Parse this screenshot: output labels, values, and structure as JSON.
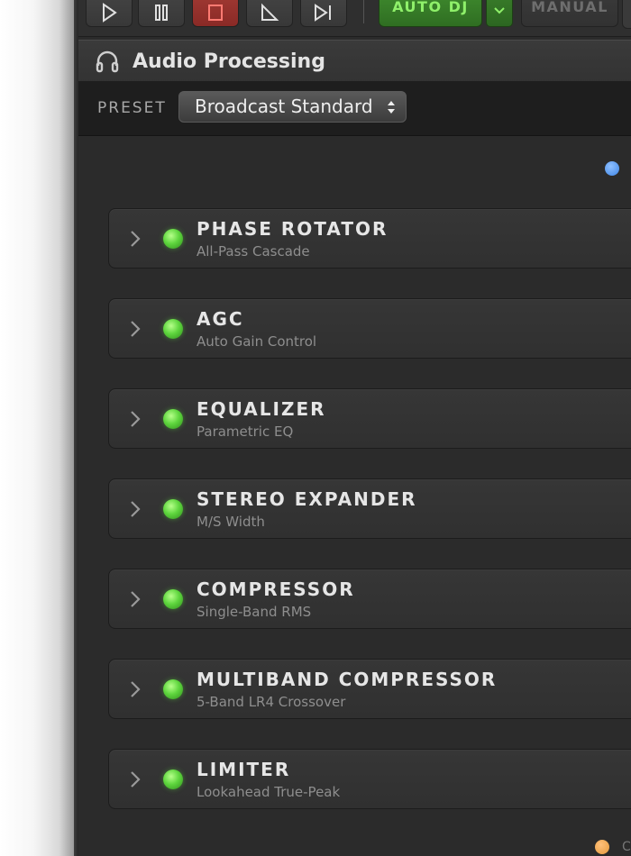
{
  "toolbar": {
    "auto_dj_label": "AUTO DJ",
    "manual_label": "MANUAL"
  },
  "panel": {
    "title": "Audio Processing",
    "preset_label": "PRESET",
    "preset_value": "Broadcast Standard"
  },
  "modules": [
    {
      "name": "PHASE ROTATOR",
      "subtitle": "All-Pass Cascade"
    },
    {
      "name": "AGC",
      "subtitle": "Auto Gain Control"
    },
    {
      "name": "EQUALIZER",
      "subtitle": "Parametric EQ"
    },
    {
      "name": "STEREO EXPANDER",
      "subtitle": "M/S Width"
    },
    {
      "name": "COMPRESSOR",
      "subtitle": "Single-Band RMS"
    },
    {
      "name": "MULTIBAND COMPRESSOR",
      "subtitle": "5-Band LR4 Crossover"
    },
    {
      "name": "LIMITER",
      "subtitle": "Lookahead True-Peak"
    }
  ],
  "footer": {
    "cut_text": "C"
  },
  "colors": {
    "accent_green": "#5fd63e",
    "status_blue": "#3f86e6",
    "status_orange": "#e59a3c",
    "stop_red": "#a23a34"
  }
}
